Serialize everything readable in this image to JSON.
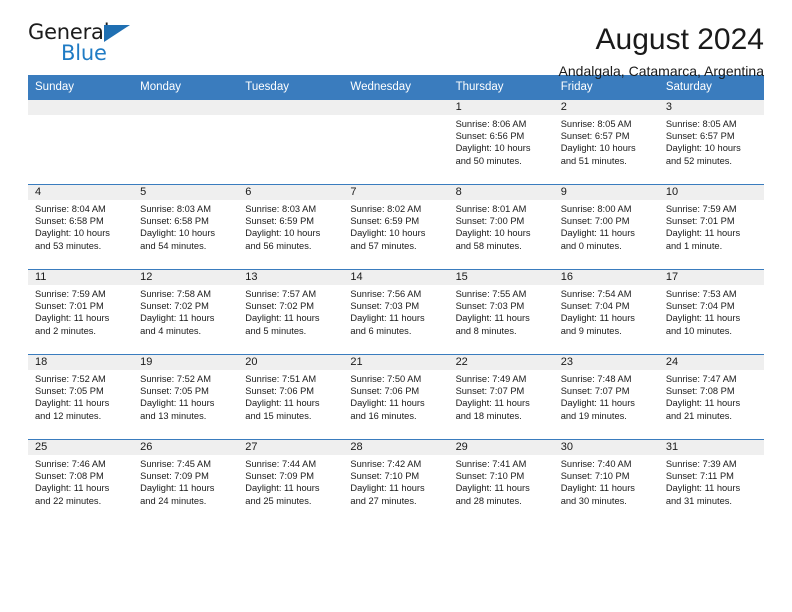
{
  "brand": {
    "name_top": "General",
    "name_bottom": "Blue",
    "triangle_color": "#1f6fb2",
    "blue_color": "#1f7bc4"
  },
  "header": {
    "title": "August 2024",
    "subtitle": "Andalgala, Catamarca, Argentina"
  },
  "theme": {
    "header_bg": "#3a7cbe",
    "daynum_bg": "#efefef",
    "grid_line": "#3a7cbe",
    "text": "#1a1a1a"
  },
  "weekdays": [
    "Sunday",
    "Monday",
    "Tuesday",
    "Wednesday",
    "Thursday",
    "Friday",
    "Saturday"
  ],
  "weeks": [
    [
      {
        "day": "",
        "empty": true,
        "sunrise": "",
        "sunset": "",
        "daylight_1": "",
        "daylight_2": ""
      },
      {
        "day": "",
        "empty": true,
        "sunrise": "",
        "sunset": "",
        "daylight_1": "",
        "daylight_2": ""
      },
      {
        "day": "",
        "empty": true,
        "sunrise": "",
        "sunset": "",
        "daylight_1": "",
        "daylight_2": ""
      },
      {
        "day": "",
        "empty": true,
        "sunrise": "",
        "sunset": "",
        "daylight_1": "",
        "daylight_2": ""
      },
      {
        "day": "1",
        "empty": false,
        "sunrise": "Sunrise: 8:06 AM",
        "sunset": "Sunset: 6:56 PM",
        "daylight_1": "Daylight: 10 hours",
        "daylight_2": "and 50 minutes."
      },
      {
        "day": "2",
        "empty": false,
        "sunrise": "Sunrise: 8:05 AM",
        "sunset": "Sunset: 6:57 PM",
        "daylight_1": "Daylight: 10 hours",
        "daylight_2": "and 51 minutes."
      },
      {
        "day": "3",
        "empty": false,
        "sunrise": "Sunrise: 8:05 AM",
        "sunset": "Sunset: 6:57 PM",
        "daylight_1": "Daylight: 10 hours",
        "daylight_2": "and 52 minutes."
      }
    ],
    [
      {
        "day": "4",
        "empty": false,
        "sunrise": "Sunrise: 8:04 AM",
        "sunset": "Sunset: 6:58 PM",
        "daylight_1": "Daylight: 10 hours",
        "daylight_2": "and 53 minutes."
      },
      {
        "day": "5",
        "empty": false,
        "sunrise": "Sunrise: 8:03 AM",
        "sunset": "Sunset: 6:58 PM",
        "daylight_1": "Daylight: 10 hours",
        "daylight_2": "and 54 minutes."
      },
      {
        "day": "6",
        "empty": false,
        "sunrise": "Sunrise: 8:03 AM",
        "sunset": "Sunset: 6:59 PM",
        "daylight_1": "Daylight: 10 hours",
        "daylight_2": "and 56 minutes."
      },
      {
        "day": "7",
        "empty": false,
        "sunrise": "Sunrise: 8:02 AM",
        "sunset": "Sunset: 6:59 PM",
        "daylight_1": "Daylight: 10 hours",
        "daylight_2": "and 57 minutes."
      },
      {
        "day": "8",
        "empty": false,
        "sunrise": "Sunrise: 8:01 AM",
        "sunset": "Sunset: 7:00 PM",
        "daylight_1": "Daylight: 10 hours",
        "daylight_2": "and 58 minutes."
      },
      {
        "day": "9",
        "empty": false,
        "sunrise": "Sunrise: 8:00 AM",
        "sunset": "Sunset: 7:00 PM",
        "daylight_1": "Daylight: 11 hours",
        "daylight_2": "and 0 minutes."
      },
      {
        "day": "10",
        "empty": false,
        "sunrise": "Sunrise: 7:59 AM",
        "sunset": "Sunset: 7:01 PM",
        "daylight_1": "Daylight: 11 hours",
        "daylight_2": "and 1 minute."
      }
    ],
    [
      {
        "day": "11",
        "empty": false,
        "sunrise": "Sunrise: 7:59 AM",
        "sunset": "Sunset: 7:01 PM",
        "daylight_1": "Daylight: 11 hours",
        "daylight_2": "and 2 minutes."
      },
      {
        "day": "12",
        "empty": false,
        "sunrise": "Sunrise: 7:58 AM",
        "sunset": "Sunset: 7:02 PM",
        "daylight_1": "Daylight: 11 hours",
        "daylight_2": "and 4 minutes."
      },
      {
        "day": "13",
        "empty": false,
        "sunrise": "Sunrise: 7:57 AM",
        "sunset": "Sunset: 7:02 PM",
        "daylight_1": "Daylight: 11 hours",
        "daylight_2": "and 5 minutes."
      },
      {
        "day": "14",
        "empty": false,
        "sunrise": "Sunrise: 7:56 AM",
        "sunset": "Sunset: 7:03 PM",
        "daylight_1": "Daylight: 11 hours",
        "daylight_2": "and 6 minutes."
      },
      {
        "day": "15",
        "empty": false,
        "sunrise": "Sunrise: 7:55 AM",
        "sunset": "Sunset: 7:03 PM",
        "daylight_1": "Daylight: 11 hours",
        "daylight_2": "and 8 minutes."
      },
      {
        "day": "16",
        "empty": false,
        "sunrise": "Sunrise: 7:54 AM",
        "sunset": "Sunset: 7:04 PM",
        "daylight_1": "Daylight: 11 hours",
        "daylight_2": "and 9 minutes."
      },
      {
        "day": "17",
        "empty": false,
        "sunrise": "Sunrise: 7:53 AM",
        "sunset": "Sunset: 7:04 PM",
        "daylight_1": "Daylight: 11 hours",
        "daylight_2": "and 10 minutes."
      }
    ],
    [
      {
        "day": "18",
        "empty": false,
        "sunrise": "Sunrise: 7:52 AM",
        "sunset": "Sunset: 7:05 PM",
        "daylight_1": "Daylight: 11 hours",
        "daylight_2": "and 12 minutes."
      },
      {
        "day": "19",
        "empty": false,
        "sunrise": "Sunrise: 7:52 AM",
        "sunset": "Sunset: 7:05 PM",
        "daylight_1": "Daylight: 11 hours",
        "daylight_2": "and 13 minutes."
      },
      {
        "day": "20",
        "empty": false,
        "sunrise": "Sunrise: 7:51 AM",
        "sunset": "Sunset: 7:06 PM",
        "daylight_1": "Daylight: 11 hours",
        "daylight_2": "and 15 minutes."
      },
      {
        "day": "21",
        "empty": false,
        "sunrise": "Sunrise: 7:50 AM",
        "sunset": "Sunset: 7:06 PM",
        "daylight_1": "Daylight: 11 hours",
        "daylight_2": "and 16 minutes."
      },
      {
        "day": "22",
        "empty": false,
        "sunrise": "Sunrise: 7:49 AM",
        "sunset": "Sunset: 7:07 PM",
        "daylight_1": "Daylight: 11 hours",
        "daylight_2": "and 18 minutes."
      },
      {
        "day": "23",
        "empty": false,
        "sunrise": "Sunrise: 7:48 AM",
        "sunset": "Sunset: 7:07 PM",
        "daylight_1": "Daylight: 11 hours",
        "daylight_2": "and 19 minutes."
      },
      {
        "day": "24",
        "empty": false,
        "sunrise": "Sunrise: 7:47 AM",
        "sunset": "Sunset: 7:08 PM",
        "daylight_1": "Daylight: 11 hours",
        "daylight_2": "and 21 minutes."
      }
    ],
    [
      {
        "day": "25",
        "empty": false,
        "sunrise": "Sunrise: 7:46 AM",
        "sunset": "Sunset: 7:08 PM",
        "daylight_1": "Daylight: 11 hours",
        "daylight_2": "and 22 minutes."
      },
      {
        "day": "26",
        "empty": false,
        "sunrise": "Sunrise: 7:45 AM",
        "sunset": "Sunset: 7:09 PM",
        "daylight_1": "Daylight: 11 hours",
        "daylight_2": "and 24 minutes."
      },
      {
        "day": "27",
        "empty": false,
        "sunrise": "Sunrise: 7:44 AM",
        "sunset": "Sunset: 7:09 PM",
        "daylight_1": "Daylight: 11 hours",
        "daylight_2": "and 25 minutes."
      },
      {
        "day": "28",
        "empty": false,
        "sunrise": "Sunrise: 7:42 AM",
        "sunset": "Sunset: 7:10 PM",
        "daylight_1": "Daylight: 11 hours",
        "daylight_2": "and 27 minutes."
      },
      {
        "day": "29",
        "empty": false,
        "sunrise": "Sunrise: 7:41 AM",
        "sunset": "Sunset: 7:10 PM",
        "daylight_1": "Daylight: 11 hours",
        "daylight_2": "and 28 minutes."
      },
      {
        "day": "30",
        "empty": false,
        "sunrise": "Sunrise: 7:40 AM",
        "sunset": "Sunset: 7:10 PM",
        "daylight_1": "Daylight: 11 hours",
        "daylight_2": "and 30 minutes."
      },
      {
        "day": "31",
        "empty": false,
        "sunrise": "Sunrise: 7:39 AM",
        "sunset": "Sunset: 7:11 PM",
        "daylight_1": "Daylight: 11 hours",
        "daylight_2": "and 31 minutes."
      }
    ]
  ]
}
